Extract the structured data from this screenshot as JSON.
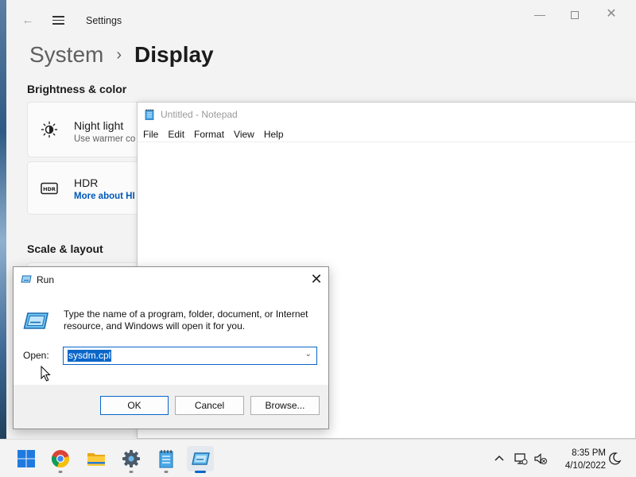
{
  "settings": {
    "app_title": "Settings",
    "breadcrumb_parent": "System",
    "breadcrumb_separator": "›",
    "breadcrumb_current": "Display",
    "section_brightness": "Brightness & color",
    "night_light": {
      "title": "Night light",
      "subtitle": "Use warmer co"
    },
    "hdr": {
      "title": "HDR",
      "link": "More about HI"
    },
    "section_scale": "Scale & layout"
  },
  "notepad": {
    "title": "Untitled - Notepad",
    "menu": [
      "File",
      "Edit",
      "Format",
      "View",
      "Help"
    ]
  },
  "run": {
    "title": "Run",
    "description": "Type the name of a program, folder, document, or Internet resource, and Windows will open it for you.",
    "open_label": "Open:",
    "open_value": "sysdm.cpl",
    "ok_label": "OK",
    "cancel_label": "Cancel",
    "browse_label": "Browse..."
  },
  "taskbar": {
    "apps": [
      "windows-start-icon",
      "chrome-icon",
      "file-explorer-icon",
      "settings-icon",
      "notepad-icon",
      "run-icon"
    ],
    "time": "8:35 PM",
    "date": "4/10/2022"
  },
  "colors": {
    "accent": "#0a66c9",
    "link": "#0058b8"
  }
}
